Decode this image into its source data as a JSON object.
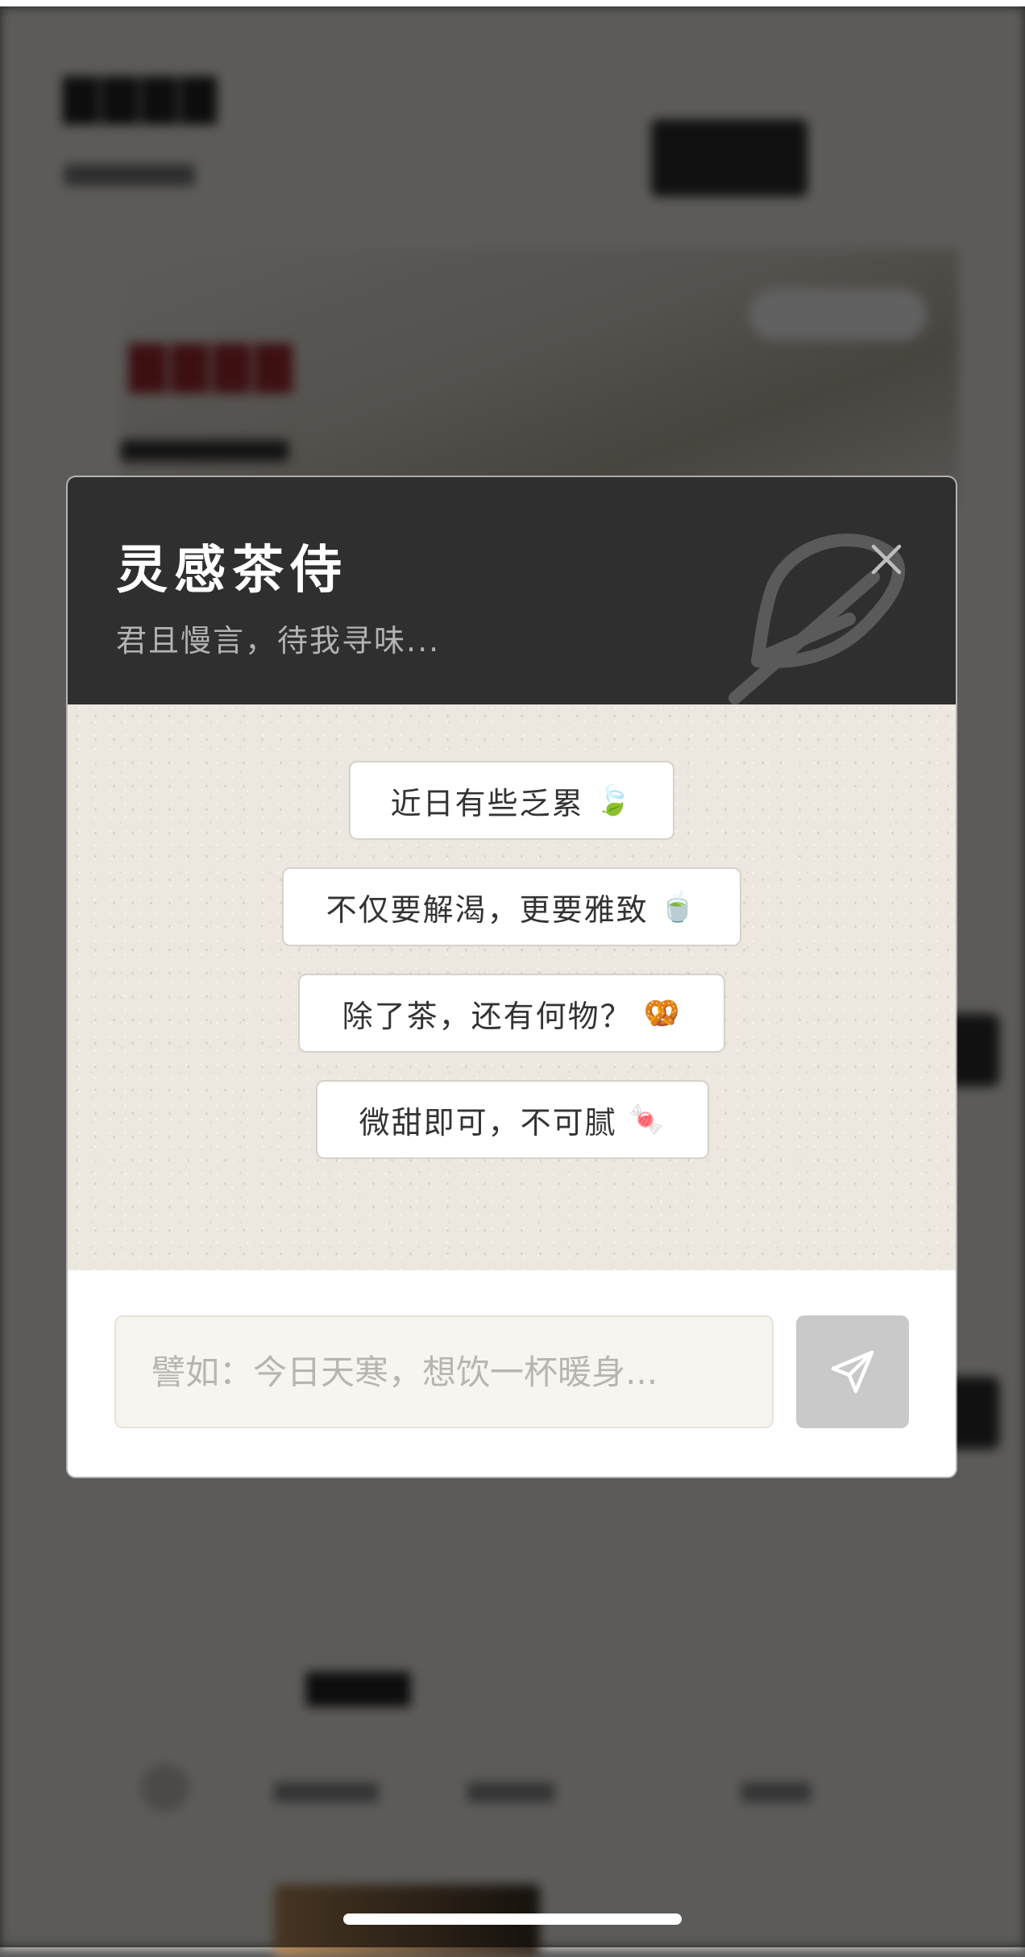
{
  "modal": {
    "title": "灵感茶侍",
    "subtitle": "君且慢言，待我寻味...",
    "close_icon": "close-icon",
    "decor_icon": "feather-icon",
    "header_color": "#2f2f2f",
    "suggestions": [
      {
        "label": "近日有些乏累",
        "emoji": "🍃"
      },
      {
        "label": "不仅要解渴，更要雅致",
        "emoji": "🍵"
      },
      {
        "label": "除了茶，还有何物？",
        "emoji": "🥨"
      },
      {
        "label": "微甜即可，不可腻",
        "emoji": "🍬"
      }
    ],
    "input": {
      "placeholder": "譬如：今日天寒，想饮一杯暖身...",
      "value": ""
    },
    "send_icon": "send-icon",
    "send_button_color": "#c9c9c9"
  }
}
